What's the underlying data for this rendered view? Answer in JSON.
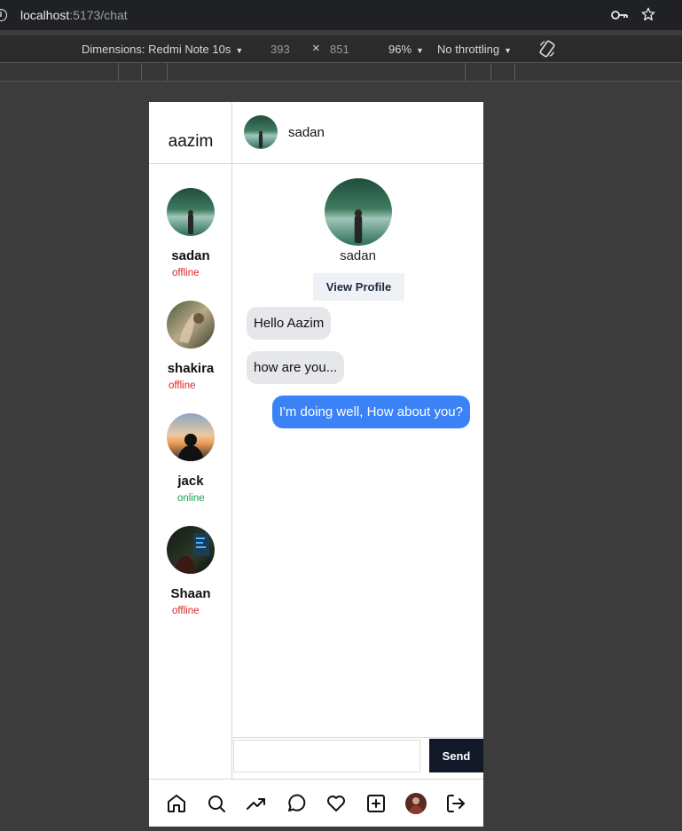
{
  "browser": {
    "url_host": "localhost",
    "url_path": ":5173/chat"
  },
  "devtools": {
    "dimensions_label": "Dimensions: Redmi Note 10s",
    "width": "393",
    "times": "×",
    "height": "851",
    "zoom": "96%",
    "throttling": "No throttling"
  },
  "app": {
    "current_user": "aazim",
    "contacts": [
      {
        "name": "sadan",
        "status": "offline"
      },
      {
        "name": "shakira",
        "status": "offline"
      },
      {
        "name": "jack",
        "status": "online"
      },
      {
        "name": "Shaan",
        "status": "offline"
      }
    ],
    "chat": {
      "header_name": "sadan",
      "profile_name": "sadan",
      "view_profile_label": "View Profile",
      "messages": [
        {
          "text": "Hello Aazim",
          "direction": "incoming"
        },
        {
          "text": "how are you...",
          "direction": "incoming"
        },
        {
          "text": "I'm doing well, How about you?",
          "direction": "outgoing"
        }
      ],
      "input_placeholder": "",
      "send_label": "Send"
    },
    "nav_icons": [
      "home-icon",
      "search-icon",
      "trending-icon",
      "chat-icon",
      "heart-icon",
      "plus-square-icon",
      "profile-avatar",
      "logout-icon"
    ],
    "colors": {
      "online": "#16a34a",
      "offline": "#dc2626",
      "outgoing_bubble": "#3b82f6",
      "incoming_bubble": "#e5e7eb",
      "send_button": "#111827"
    }
  }
}
